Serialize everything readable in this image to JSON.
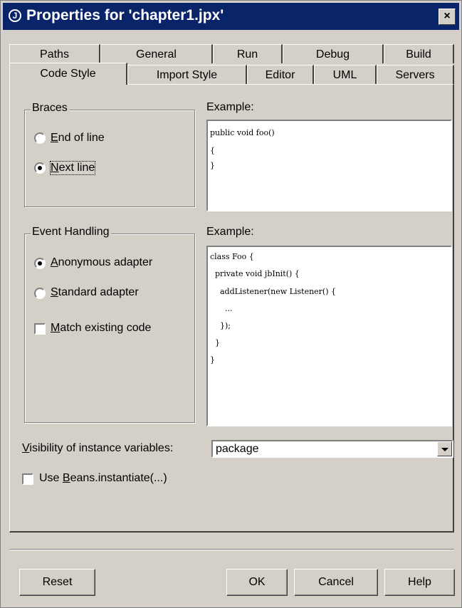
{
  "window": {
    "title": "Properties for 'chapter1.jpx'",
    "close": "×",
    "icon_glyph": "J"
  },
  "tabs": {
    "row1": [
      "Paths",
      "General",
      "Run",
      "Debug",
      "Build"
    ],
    "row2": [
      "Code Style",
      "Import Style",
      "Editor",
      "UML",
      "Servers"
    ],
    "active": "Code Style"
  },
  "braces": {
    "group_title": "Braces",
    "options": [
      {
        "label": "End of line",
        "mnemonic": "E",
        "rest": "nd of line",
        "checked": false
      },
      {
        "label": "Next line",
        "mnemonic": "N",
        "rest": "ext line",
        "checked": true
      }
    ],
    "example_label": "Example:",
    "example_lines": [
      "public void foo()",
      "{",
      "}"
    ]
  },
  "event_handling": {
    "group_title": "Event Handling",
    "options": [
      {
        "label": "Anonymous adapter",
        "mnemonic": "A",
        "rest": "nonymous adapter",
        "checked": true
      },
      {
        "label": "Standard adapter",
        "mnemonic": "S",
        "rest": "tandard adapter",
        "checked": false
      }
    ],
    "checkbox": {
      "label": "Match existing code",
      "mnemonic": "M",
      "rest": "atch existing code",
      "checked": false
    },
    "example_label": "Example:",
    "example_lines": [
      "class Foo {",
      "  private void jbInit() {",
      "    addListener(new Listener() {",
      "      ...",
      "    });",
      "  }",
      "}"
    ]
  },
  "visibility": {
    "label_mnemonic": "V",
    "label_rest": "isibility of instance variables:",
    "value": "package"
  },
  "beans": {
    "label_pre": "Use ",
    "label_mnemonic": "B",
    "label_rest": "eans.instantiate(...)",
    "checked": false
  },
  "buttons": {
    "reset": "Reset",
    "ok": "OK",
    "cancel": "Cancel",
    "help": "Help"
  },
  "colors": {
    "titlebar": "#0a246a",
    "face": "#d4d0c8"
  }
}
